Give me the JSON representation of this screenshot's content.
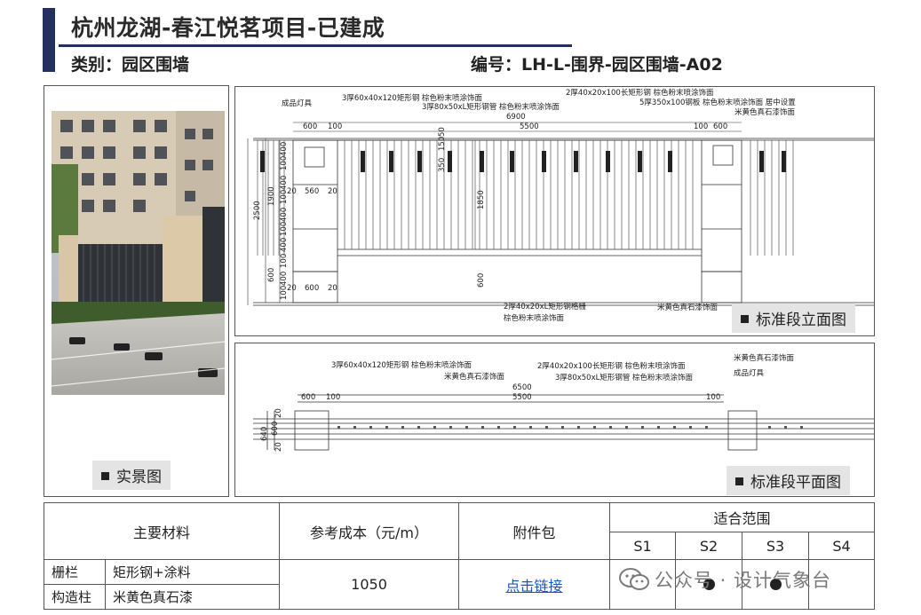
{
  "header": {
    "title": "杭州龙湖-春江悦茗项目-已建成",
    "category": "类别：园区围墙",
    "code": "编号：LH-L-围界-园区围墙-A02"
  },
  "photo_panel": {
    "label": "实景图"
  },
  "elevation_panel": {
    "label": "标准段立面图",
    "annotations": {
      "lamp": "成品灯具",
      "steel_60": "3厚60x40x120矩形钢 棕色粉末喷涂饰面",
      "steel_80": "3厚80x50xL矩形钢管 棕色粉末喷涂饰面",
      "steel_40_100": "2厚40x20x100长矩形钢 棕色粉末喷涂饰面",
      "steel_plate": "5厚350x100钢板 棕色粉末喷涂饰面 居中设置",
      "paint_top": "米黄色真石漆饰面",
      "grille_1": "2厚40x20xL矩形钢格栅",
      "grille_2": "棕色粉末喷涂饰面",
      "paint_bottom": "米黄色真石漆饰面"
    },
    "dims": {
      "d6900": "6900",
      "d5500": "5500",
      "d600a": "600",
      "d100a": "100",
      "d100b": "100",
      "d600b": "600",
      "d2500": "2500",
      "d1900": "1900",
      "d1850": "1850",
      "d350": "350",
      "d150": "150",
      "d50": "50",
      "d20a": "20",
      "d560": "560",
      "d20b": "20",
      "d20c": "20",
      "d600c": "600",
      "d20d": "20",
      "d600v": "600",
      "d600m": "600",
      "v400a": "400",
      "v100a": "100",
      "v400b": "400",
      "v100b": "100",
      "v400c": "400",
      "v100c": "100",
      "v400d": "400",
      "v100d": "100",
      "v400e": "400",
      "v100e": "100"
    }
  },
  "plan_panel": {
    "label": "标准段平面图",
    "annotations": {
      "steel_60": "3厚60x40x120矩形钢 棕色粉末喷涂饰面",
      "paint": "米黄色真石漆饰面",
      "steel_40_100": "2厚40x20x100长矩形钢 棕色粉末喷涂饰面",
      "steel_80": "3厚80x50xL矩形钢管 棕色粉末喷涂饰面",
      "paint_right": "米黄色真石漆饰面",
      "lamp": "成品灯具"
    },
    "dims": {
      "d6500": "6500",
      "d5500": "5500",
      "d600": "600",
      "d100a": "100",
      "d100b": "100",
      "v640": "640",
      "v600": "600",
      "v20a": "20",
      "v20b": "20"
    }
  },
  "table": {
    "headers": {
      "material": "主要材料",
      "cost": "参考成本（元/m）",
      "package": "附件包",
      "scope": "适合范围"
    },
    "scope_cols": [
      "S1",
      "S2",
      "S3",
      "S4"
    ],
    "rows": [
      {
        "item": "栅栏",
        "material": "矩形钢+涂料"
      },
      {
        "item": "构造柱",
        "material": "米黄色真石漆"
      }
    ],
    "cost_value": "1050",
    "package_link": "点击链接"
  },
  "watermark": "公众号 · 设计气象台"
}
